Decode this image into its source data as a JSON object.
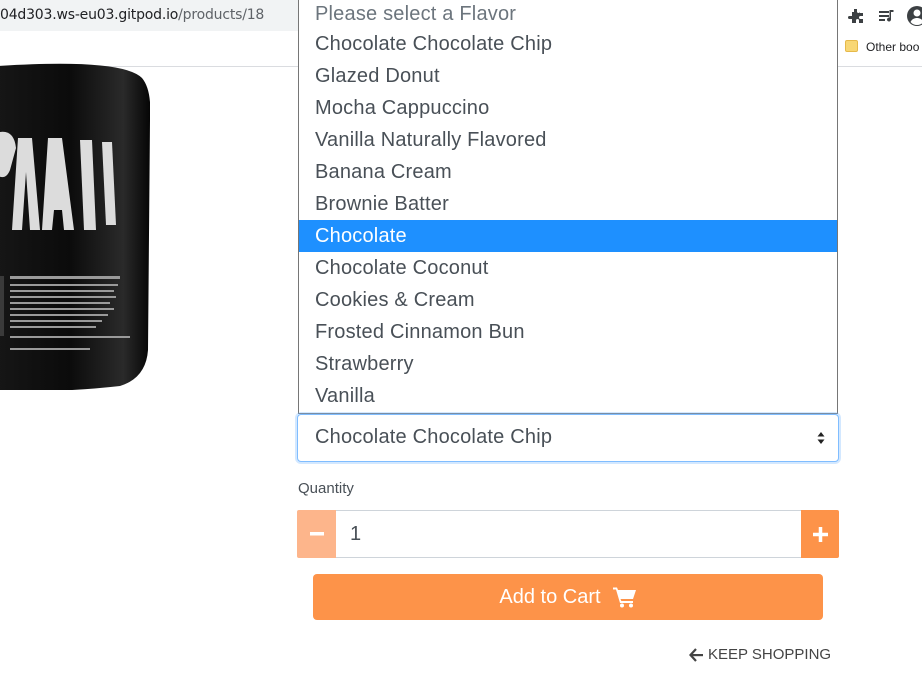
{
  "browser": {
    "url_host": "04d303.ws-eu03.gitpod.io",
    "url_path": "/products/18",
    "other_bookmarks": "Other boo",
    "icons": [
      "extensions-icon",
      "reading-list-icon",
      "profile-icon"
    ]
  },
  "product": {
    "image_icon": "product-tub-image"
  },
  "flavor_select": {
    "options": [
      "Please select a Flavor",
      "Chocolate Chocolate Chip",
      "Glazed Donut",
      "Mocha Cappuccino",
      "Vanilla Naturally Flavored",
      "Banana Cream",
      "Brownie Batter",
      "Chocolate",
      "Chocolate Coconut",
      "Cookies & Cream",
      "Frosted Cinnamon Bun",
      "Strawberry",
      "Vanilla"
    ],
    "highlighted_option": "Chocolate",
    "current_value": "Chocolate Chocolate Chip",
    "caret": "⬍"
  },
  "quantity": {
    "label": "Quantity",
    "value": "1",
    "minus": "−",
    "plus": "+"
  },
  "cart": {
    "button_label": "Add to Cart",
    "icon": "shopping-cart-icon"
  },
  "keep_shopping": {
    "label": "KEEP SHOPPING",
    "icon": "arrow-left-icon"
  },
  "colors": {
    "accent_orange": "#fd9349",
    "accent_orange_light": "#fdb58b",
    "highlight_blue": "#1e90ff"
  }
}
